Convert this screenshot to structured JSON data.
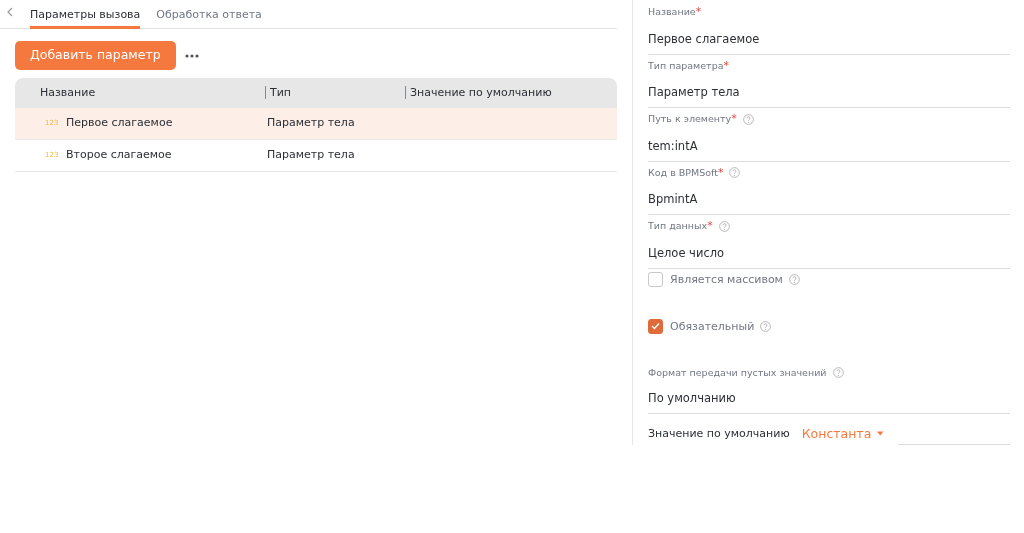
{
  "tabs": [
    {
      "label": "Параметры вызова",
      "selected": true
    },
    {
      "label": "Обработка ответа",
      "selected": false
    }
  ],
  "add_button": "Добавить параметр",
  "table": {
    "columns": [
      "Название",
      "Тип",
      "Значение по умолчанию"
    ],
    "rows": [
      {
        "type_icon": "123",
        "name": "Первое слагаемое",
        "type": "Параметр тела",
        "selected": true
      },
      {
        "type_icon": "123",
        "name": "Второе слагаемое",
        "type": "Параметр тела",
        "selected": false
      }
    ]
  },
  "form": {
    "items": [
      {
        "kind": "field",
        "label": "Название",
        "required_mark": "*",
        "help": false,
        "value": "Первое слагаемое"
      },
      {
        "kind": "field",
        "label": "Тип параметра",
        "required_mark": "*",
        "help": false,
        "value": "Параметр тела"
      },
      {
        "kind": "field",
        "label": "Путь к элементу",
        "required_mark": "*",
        "help": true,
        "value": "tem:intA"
      },
      {
        "kind": "field",
        "label": "Код в BPMSoft",
        "required_mark": "*",
        "help": true,
        "value": "BpmintA"
      },
      {
        "kind": "field",
        "label": "Тип данных",
        "required_mark": "*",
        "help": true,
        "value": "Целое число"
      },
      {
        "kind": "checkbox",
        "label": "Является массивом",
        "checked": false,
        "help": true
      },
      {
        "kind": "checkbox",
        "label": "Обязательный",
        "checked": true,
        "help": true
      },
      {
        "kind": "field",
        "label": "Формат передачи пустых значений",
        "help": true,
        "value": "По умолчанию"
      }
    ],
    "default_value": {
      "label": "Значение по умолчанию",
      "mode": "Константа"
    }
  }
}
